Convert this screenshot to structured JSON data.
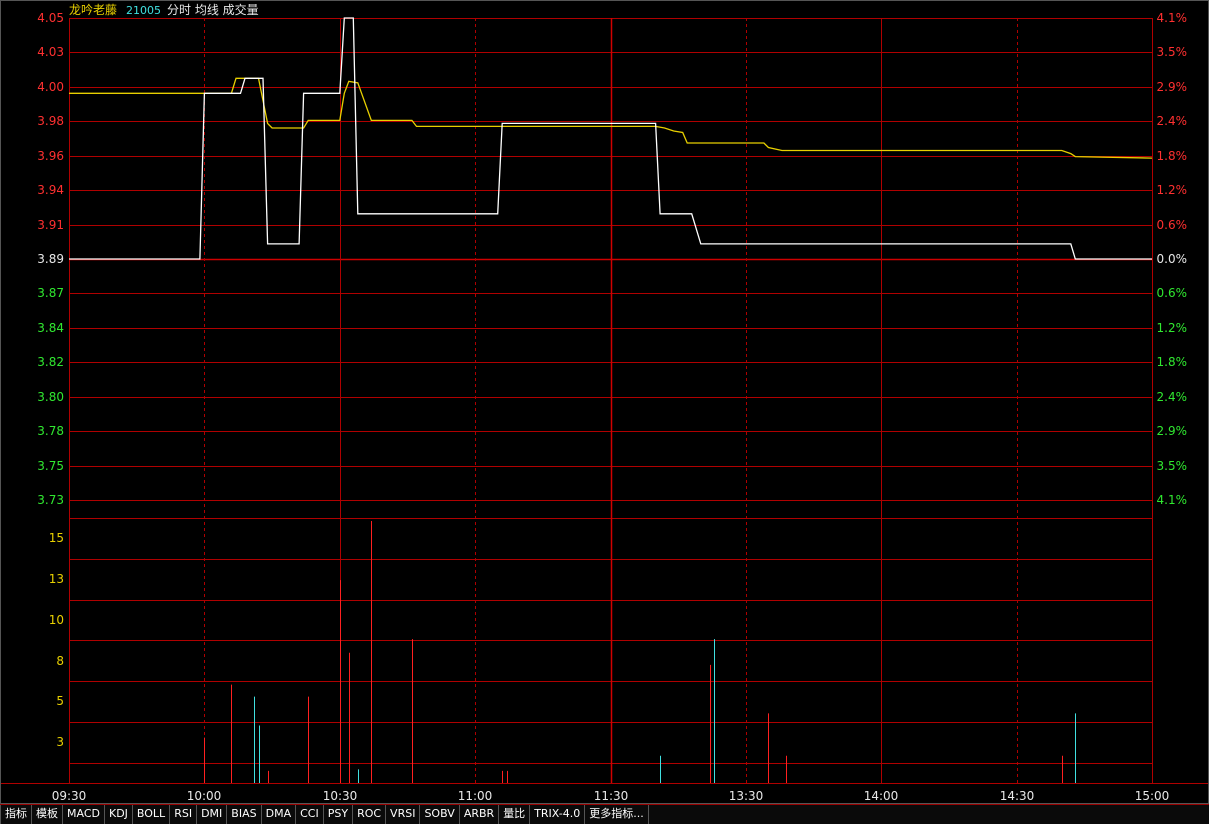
{
  "header": {
    "name": "龙吟老藤",
    "code": "21005",
    "legend": "分时 均线 成交量"
  },
  "colors": {
    "background": "#000000",
    "grid": "#b00000",
    "grid_center": "#d00000",
    "price_line": "#ffffff",
    "avg_line": "#e8d000",
    "up_label": "#ff3030",
    "down_label": "#30e830",
    "volume_label": "#e8d000",
    "vol_up": "#ff2020",
    "vol_down": "#40e0e0"
  },
  "chart_data": {
    "type": "line",
    "prev_close": 3.89,
    "price_ticks_up": [
      "4.05",
      "4.03",
      "4.00",
      "3.98",
      "3.96",
      "3.94",
      "3.91"
    ],
    "price_tick_center": "3.89",
    "price_ticks_down": [
      "3.87",
      "3.84",
      "3.82",
      "3.80",
      "3.78",
      "3.75",
      "3.73"
    ],
    "pct_ticks_up": [
      "4.1%",
      "3.5%",
      "2.9%",
      "2.4%",
      "1.8%",
      "1.2%",
      "0.6%"
    ],
    "pct_tick_center": "0.0%",
    "pct_ticks_down": [
      "0.6%",
      "1.2%",
      "1.8%",
      "2.4%",
      "2.9%",
      "3.5%",
      "4.1%"
    ],
    "volume_ticks": [
      "15",
      "13",
      "10",
      "8",
      "5",
      "3"
    ],
    "ylim_price": [
      3.73,
      4.05
    ],
    "ylim_volume": [
      0,
      17.5
    ],
    "x_ticks": [
      "09:30",
      "10:00",
      "10:30",
      "11:00",
      "11:30",
      "13:30",
      "14:00",
      "14:30",
      "15:00"
    ],
    "price_series": [
      [
        0,
        3.89
      ],
      [
        29,
        3.89
      ],
      [
        30,
        4.0
      ],
      [
        38,
        4.0
      ],
      [
        39,
        4.01
      ],
      [
        43,
        4.01
      ],
      [
        44,
        3.9
      ],
      [
        51,
        3.9
      ],
      [
        52,
        4.0
      ],
      [
        60,
        4.0
      ],
      [
        61,
        4.05
      ],
      [
        63,
        4.05
      ],
      [
        64,
        3.92
      ],
      [
        95,
        3.92
      ],
      [
        96,
        3.98
      ],
      [
        130,
        3.98
      ],
      [
        131,
        3.92
      ],
      [
        138,
        3.92
      ],
      [
        140,
        3.9
      ],
      [
        222,
        3.9
      ],
      [
        223,
        3.89
      ],
      [
        240,
        3.89
      ]
    ],
    "avg_series": [
      [
        0,
        4.0
      ],
      [
        36,
        4.0
      ],
      [
        37,
        4.01
      ],
      [
        42,
        4.01
      ],
      [
        44,
        3.98
      ],
      [
        45,
        3.977
      ],
      [
        52,
        3.977
      ],
      [
        53,
        3.982
      ],
      [
        60,
        3.982
      ],
      [
        61,
        4.0
      ],
      [
        62,
        4.008
      ],
      [
        64,
        4.007
      ],
      [
        67,
        3.982
      ],
      [
        76,
        3.982
      ],
      [
        77,
        3.978
      ],
      [
        130,
        3.978
      ],
      [
        132,
        3.977
      ],
      [
        134,
        3.975
      ],
      [
        136,
        3.974
      ],
      [
        137,
        3.967
      ],
      [
        154,
        3.967
      ],
      [
        155,
        3.964
      ],
      [
        158,
        3.962
      ],
      [
        220,
        3.962
      ],
      [
        222,
        3.96
      ],
      [
        223,
        3.958
      ],
      [
        240,
        3.957
      ]
    ],
    "volume": [
      {
        "t": 30,
        "v": 3.0,
        "dir": "up"
      },
      {
        "t": 36,
        "v": 6.5,
        "dir": "up"
      },
      {
        "t": 41,
        "v": 5.7,
        "dir": "down"
      },
      {
        "t": 42,
        "v": 3.8,
        "dir": "down"
      },
      {
        "t": 44,
        "v": 0.8,
        "dir": "up"
      },
      {
        "t": 53,
        "v": 5.7,
        "dir": "up"
      },
      {
        "t": 60,
        "v": 13.4,
        "dir": "up"
      },
      {
        "t": 62,
        "v": 8.6,
        "dir": "up"
      },
      {
        "t": 64,
        "v": 0.9,
        "dir": "down"
      },
      {
        "t": 67,
        "v": 17.3,
        "dir": "up"
      },
      {
        "t": 76,
        "v": 9.5,
        "dir": "up"
      },
      {
        "t": 96,
        "v": 0.8,
        "dir": "up"
      },
      {
        "t": 97,
        "v": 0.8,
        "dir": "up"
      },
      {
        "t": 131,
        "v": 1.8,
        "dir": "down"
      },
      {
        "t": 142,
        "v": 7.8,
        "dir": "up"
      },
      {
        "t": 143,
        "v": 9.5,
        "dir": "down"
      },
      {
        "t": 155,
        "v": 4.6,
        "dir": "up"
      },
      {
        "t": 159,
        "v": 1.8,
        "dir": "up"
      },
      {
        "t": 220,
        "v": 1.8,
        "dir": "up"
      },
      {
        "t": 223,
        "v": 4.6,
        "dir": "down"
      }
    ]
  },
  "tabs": [
    "指标",
    "模板",
    "MACD",
    "KDJ",
    "BOLL",
    "RSI",
    "DMI",
    "BIAS",
    "DMA",
    "CCI",
    "PSY",
    "ROC",
    "VRSI",
    "SOBV",
    "ARBR",
    "量比",
    "TRIX-4.0",
    "更多指标..."
  ]
}
